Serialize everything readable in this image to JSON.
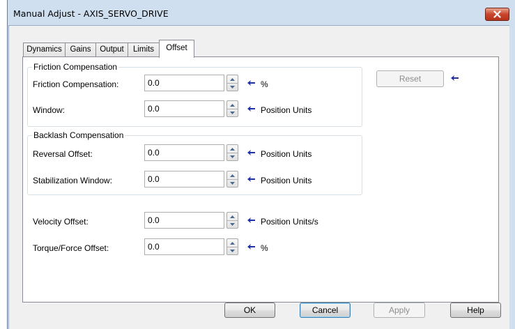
{
  "window": {
    "title": "Manual Adjust - AXIS_SERVO_DRIVE"
  },
  "tabs": [
    {
      "label": "Dynamics",
      "active": false
    },
    {
      "label": "Gains",
      "active": false
    },
    {
      "label": "Output",
      "active": false
    },
    {
      "label": "Limits",
      "active": false
    },
    {
      "label": "Offset",
      "active": true
    }
  ],
  "friction_group": {
    "title": "Friction Compensation",
    "fields": [
      {
        "label": "Friction Compensation:",
        "value": "0.0",
        "unit": "%"
      },
      {
        "label": "Window:",
        "value": "0.0",
        "unit": "Position Units"
      }
    ]
  },
  "backlash_group": {
    "title": "Backlash Compensation",
    "fields": [
      {
        "label": "Reversal Offset:",
        "value": "0.0",
        "unit": "Position Units"
      },
      {
        "label": "Stabilization Window:",
        "value": "0.0",
        "unit": "Position Units"
      }
    ]
  },
  "offsets": [
    {
      "label": "Velocity Offset:",
      "value": "0.0",
      "unit": "Position Units/s"
    },
    {
      "label": "Torque/Force Offset:",
      "value": "0.0",
      "unit": "%"
    }
  ],
  "reset_button": {
    "label": "Reset",
    "enabled": false
  },
  "footer": {
    "ok_label": "OK",
    "cancel_label": "Cancel",
    "apply_label": "Apply",
    "help_label": "Help"
  },
  "colors": {
    "title_bar": "#cfdff0",
    "close_button": "#c8452b",
    "marker_arrow": "#1f2fa8"
  },
  "icons": [
    "close-icon",
    "spin-up-icon",
    "spin-down-icon",
    "pending-change-arrow-icon"
  ]
}
